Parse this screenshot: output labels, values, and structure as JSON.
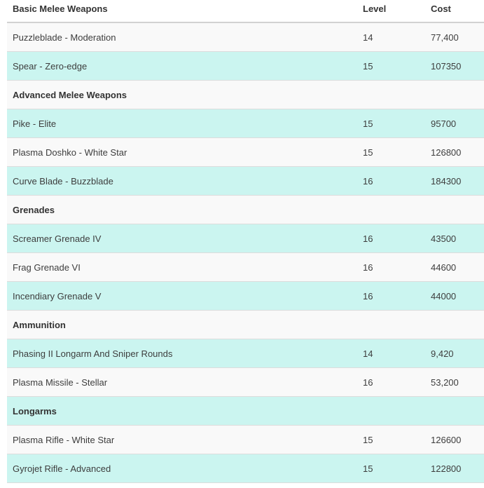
{
  "columns": {
    "first": "Basic Melee Weapons",
    "level": "Level",
    "cost": "Cost"
  },
  "rows": [
    {
      "type": "item",
      "name": "Puzzleblade - Moderation",
      "level": "14",
      "cost": "77,400",
      "bg": "light"
    },
    {
      "type": "item",
      "name": "Spear - Zero-edge",
      "level": "15",
      "cost": "107350",
      "bg": "teal"
    },
    {
      "type": "category",
      "name": "Advanced Melee Weapons",
      "bg": "light"
    },
    {
      "type": "item",
      "name": "Pike - Elite",
      "level": "15",
      "cost": "95700",
      "bg": "teal"
    },
    {
      "type": "item",
      "name": "Plasma Doshko - White Star",
      "level": "15",
      "cost": "126800",
      "bg": "light"
    },
    {
      "type": "item",
      "name": "Curve Blade - Buzzblade",
      "level": "16",
      "cost": "184300",
      "bg": "teal"
    },
    {
      "type": "category",
      "name": "Grenades",
      "bg": "light"
    },
    {
      "type": "item",
      "name": "Screamer Grenade IV",
      "level": "16",
      "cost": "43500",
      "bg": "teal"
    },
    {
      "type": "item",
      "name": "Frag Grenade VI",
      "level": "16",
      "cost": "44600",
      "bg": "light"
    },
    {
      "type": "item",
      "name": "Incendiary Grenade V",
      "level": "16",
      "cost": "44000",
      "bg": "teal"
    },
    {
      "type": "category",
      "name": "Ammunition",
      "bg": "light"
    },
    {
      "type": "item",
      "name": "Phasing II Longarm And Sniper Rounds",
      "level": "14",
      "cost": "9,420",
      "bg": "teal"
    },
    {
      "type": "item",
      "name": "Plasma Missile - Stellar",
      "level": "16",
      "cost": "53,200",
      "bg": "light"
    },
    {
      "type": "category",
      "name": "Longarms",
      "bg": "teal"
    },
    {
      "type": "item",
      "name": "Plasma Rifle - White Star",
      "level": "15",
      "cost": "126600",
      "bg": "light"
    },
    {
      "type": "item",
      "name": "Gyrojet Rifle - Advanced",
      "level": "15",
      "cost": "122800",
      "bg": "teal"
    }
  ]
}
